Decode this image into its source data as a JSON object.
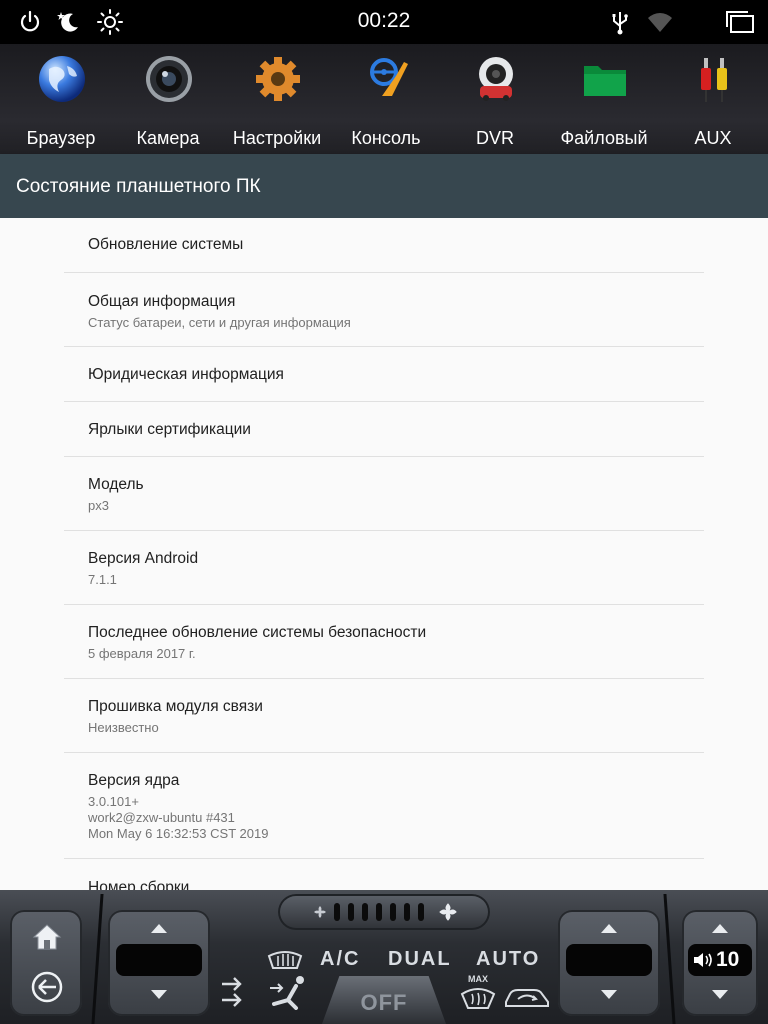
{
  "status_bar": {
    "time": "00:22",
    "icons": [
      "power-icon",
      "night-mode-icon",
      "brightness-icon",
      "usb-icon",
      "wifi-icon",
      "recent-apps-icon"
    ]
  },
  "apps": [
    {
      "label": "Браузер",
      "icon": "globe-icon"
    },
    {
      "label": "Камера",
      "icon": "camera-lens-icon"
    },
    {
      "label": "Настройки",
      "icon": "gear-icon"
    },
    {
      "label": "Консоль",
      "icon": "steering-wheel-icon"
    },
    {
      "label": "DVR",
      "icon": "dashcam-icon"
    },
    {
      "label": "Файловый",
      "icon": "folder-icon"
    },
    {
      "label": "AUX",
      "icon": "rca-cable-icon"
    }
  ],
  "header": {
    "title": "Состояние планшетного ПК"
  },
  "list": {
    "items": [
      {
        "title": "Обновление системы",
        "subtitle": ""
      },
      {
        "title": "Общая информация",
        "subtitle": "Статус батареи, сети и другая информация"
      },
      {
        "title": "Юридическая информация",
        "subtitle": ""
      },
      {
        "title": "Ярлыки сертификации",
        "subtitle": ""
      },
      {
        "title": "Модель",
        "subtitle": "px3"
      },
      {
        "title": "Версия Android",
        "subtitle": "7.1.1"
      },
      {
        "title": "Последнее обновление системы безопасности",
        "subtitle": "5 февраля 2017 г."
      },
      {
        "title": "Прошивка модуля связи",
        "subtitle": "Неизвестно"
      },
      {
        "title": "Версия ядра",
        "subtitle": "3.0.101+\nwork2@zxw-ubuntu #431\nMon May 6 16:32:53 CST 2019"
      },
      {
        "title": "Номер сборки",
        "subtitle": ""
      }
    ]
  },
  "climate": {
    "ac_label": "A/C",
    "dual_label": "DUAL",
    "auto_label": "AUTO",
    "off_label": "OFF",
    "max_label": "MAX",
    "volume": "10"
  },
  "colors": {
    "title_bar": "#37474f",
    "list_bg": "#fafafa",
    "divider": "#e0e0e0"
  }
}
